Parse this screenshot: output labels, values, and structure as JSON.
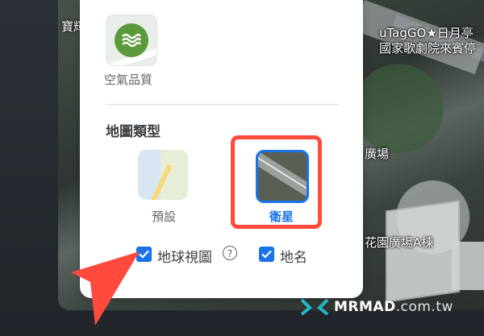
{
  "map": {
    "labels": {
      "left_edge": "寶輝",
      "poi_line1": "uTagGO★日月亭",
      "poi_line2": "國家歌劇院來賓停",
      "plaza": "廣場",
      "building": "花園廣場A棟"
    }
  },
  "panel": {
    "air_quality_label": "空氣品質",
    "map_type_title": "地圖類型",
    "map_types": [
      {
        "label": "預設",
        "selected": false
      },
      {
        "label": "衛星",
        "selected": true
      }
    ],
    "globe_view_label": "地球視圖",
    "globe_view_checked": true,
    "help_icon_text": "?",
    "place_labels_label": "地名",
    "place_labels_checked": true
  },
  "watermark": {
    "brand": "MRMAD",
    "suffix": ".com.tw"
  },
  "colors": {
    "accent_blue": "#1a73e8",
    "highlight_red": "#ff4a3d",
    "air_quality_green": "#5a9a3a"
  }
}
